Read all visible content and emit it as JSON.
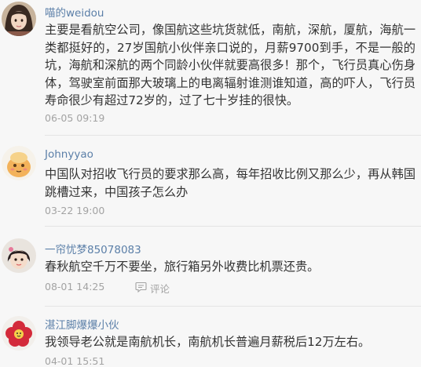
{
  "comments": [
    {
      "username": "喵的weidou",
      "text": "主要是看航空公司，像国航这些坑货就低，南航，深航，厦航，海航一类都挺好的，27岁国航小伙伴亲口说的，月薪9700到手，不是一般的坑，海航和深航的两个同龄小伙伴就要高很多！那个，飞行员真心伤身体，驾驶室前面那大玻璃上的电离辐射谁测谁知道，高的吓人，飞行员寿命很少有超过72岁的，过了七十岁挂的很快。",
      "time": "06-05 09:19",
      "avatar": "girl-avatar-icon"
    },
    {
      "username": "Johnyyao",
      "text": "中国队对招收飞行员的要求那么高，每年招收比例又那么少，再从韩国跳槽过来，中国孩子怎么办",
      "time": "03-22 19:00",
      "avatar": "cartoon-avatar-icon"
    },
    {
      "username": "一帘忧梦85078083",
      "text": "春秋航空千万不要坐，旅行箱另外收费比机票还贵。",
      "time": "08-01 14:25",
      "reply_label": "评论",
      "avatar": "child-avatar-icon"
    },
    {
      "username": "湛江脚爆爆小伙",
      "text": "我领导老公就是南航机长，南航机长普遍月薪税后12万左右。",
      "time": "04-01 15:51",
      "avatar": "red-flower-avatar-icon"
    }
  ],
  "colors": {
    "username": "#5b7fa8",
    "meta": "#a3a3a3",
    "text": "#333333",
    "background": "#f7f7f7"
  }
}
